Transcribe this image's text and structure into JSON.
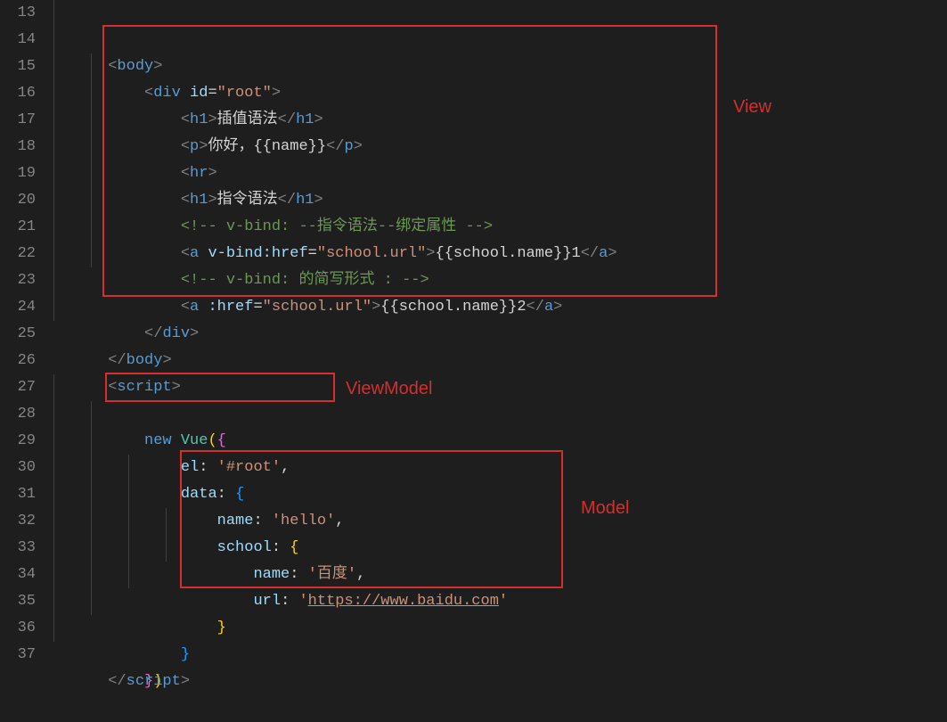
{
  "annotations": {
    "view_label": "View",
    "viewmodel_label": "ViewModel",
    "model_label": "Model"
  },
  "line_numbers": [
    "13",
    "14",
    "15",
    "16",
    "17",
    "18",
    "19",
    "20",
    "21",
    "22",
    "23",
    "24",
    "25",
    "26",
    "27",
    "28",
    "29",
    "30",
    "31",
    "32",
    "33",
    "34",
    "35",
    "36",
    "37"
  ],
  "code": {
    "l13": {
      "tag_open": "<",
      "tag": "body",
      "tag_close": ">"
    },
    "l14": {
      "tag_open": "<",
      "tag": "div",
      "attr": "id",
      "eq": "=",
      "val": "\"root\"",
      "tag_close": ">"
    },
    "l15": {
      "open": "<",
      "tag": "h1",
      "gt": ">",
      "text": "插值语法",
      "close_open": "</",
      "close_tag": "h1",
      "close_gt": ">"
    },
    "l16": {
      "open": "<",
      "tag": "p",
      "gt": ">",
      "text": "你好，{{name}}",
      "close_open": "</",
      "close_tag": "p",
      "close_gt": ">"
    },
    "l17": {
      "open": "<",
      "tag": "hr",
      "gt": ">"
    },
    "l18": {
      "open": "<",
      "tag": "h1",
      "gt": ">",
      "text": "指令语法",
      "close_open": "</",
      "close_tag": "h1",
      "close_gt": ">"
    },
    "l19": {
      "comment": "<!-- v-bind: --指令语法--绑定属性 -->"
    },
    "l20": {
      "open": "<",
      "tag": "a",
      "attr": "v-bind:href",
      "eq": "=",
      "val": "\"school.url\"",
      "gt": ">",
      "text": "{{school.name}}1",
      "close_open": "</",
      "close_tag": "a",
      "close_gt": ">"
    },
    "l21": {
      "comment": "<!-- v-bind: 的简写形式 : -->"
    },
    "l22": {
      "open": "<",
      "tag": "a",
      "attr": ":href",
      "eq": "=",
      "val": "\"school.url\"",
      "gt": ">",
      "text": "{{school.name}}2",
      "close_open": "</",
      "close_tag": "a",
      "close_gt": ">"
    },
    "l23": {
      "close_open": "</",
      "close_tag": "div",
      "close_gt": ">"
    },
    "l24": {},
    "l25": {
      "close_open": "</",
      "close_tag": "body",
      "close_gt": ">"
    },
    "l26": {
      "open": "<",
      "tag": "script",
      "gt": ">"
    },
    "l27": {
      "kw": "new",
      "cls": "Vue",
      "paren_open": "(",
      "brace_open": "{"
    },
    "l28": {
      "prop": "el",
      "colon": ":",
      "val": "'#root'",
      "comma": ","
    },
    "l29": {
      "prop": "data",
      "colon": ":",
      "brace": "{"
    },
    "l30": {
      "prop": "name",
      "colon": ":",
      "val": "'hello'",
      "comma": ","
    },
    "l31": {
      "prop": "school",
      "colon": ":",
      "brace": "{"
    },
    "l32": {
      "prop": "name",
      "colon": ":",
      "val": "'百度'",
      "comma": ","
    },
    "l33": {
      "prop": "url",
      "colon": ":",
      "val_open": "'",
      "val": "https://www.baidu.com",
      "val_close": "'"
    },
    "l34": {
      "brace": "}"
    },
    "l35": {
      "brace": "}"
    },
    "l36": {
      "brace": "}",
      "paren": ")"
    },
    "l37": {
      "close_open": "</",
      "close_tag": "script",
      "close_gt": ">"
    }
  }
}
